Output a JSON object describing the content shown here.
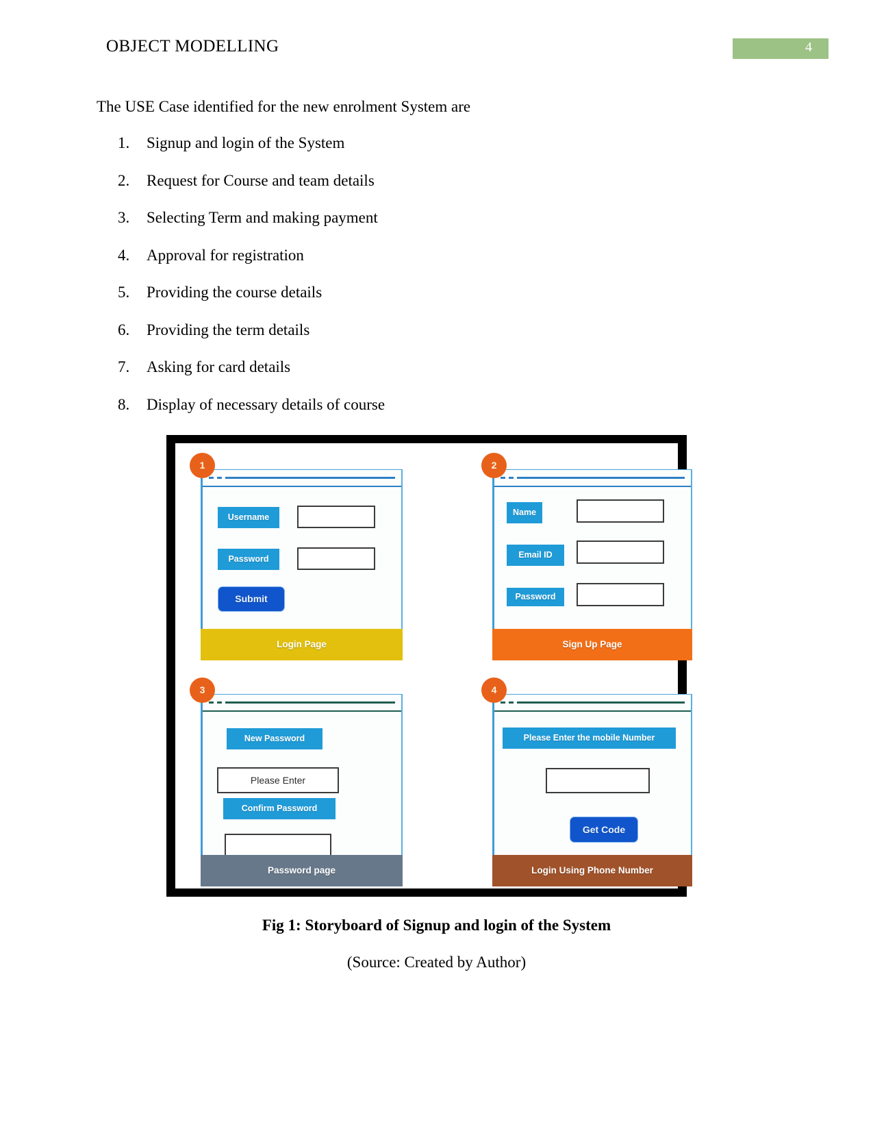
{
  "header": {
    "title": "OBJECT MODELLING",
    "page_number": "4",
    "badge_color": "#9DC285"
  },
  "body": {
    "intro": "The USE Case identified for the new enrolment System are",
    "use_cases": [
      {
        "num": "1.",
        "text": "Signup and login of the System"
      },
      {
        "num": "2.",
        "text": "Request for Course and team details"
      },
      {
        "num": "3.",
        "text": "Selecting Term and making payment"
      },
      {
        "num": "4.",
        "text": "Approval for registration"
      },
      {
        "num": "5.",
        "text": "Providing the course details"
      },
      {
        "num": "6.",
        "text": "Providing the term details"
      },
      {
        "num": "7.",
        "text": "Asking for card details"
      },
      {
        "num": "8.",
        "text": "Display of necessary details of course"
      }
    ]
  },
  "storyboard": {
    "panels": [
      {
        "step": "1",
        "footer_label": "Login Page",
        "footer_color": "#E2C00D",
        "fields": [
          {
            "label": "Username",
            "value": ""
          },
          {
            "label": "Password",
            "value": ""
          }
        ],
        "button": "Submit"
      },
      {
        "step": "2",
        "footer_label": "Sign Up Page",
        "footer_color": "#F26F17",
        "fields": [
          {
            "label": "Name",
            "value": ""
          },
          {
            "label": "Email ID",
            "value": ""
          },
          {
            "label": "Password",
            "value": ""
          }
        ],
        "button": ""
      },
      {
        "step": "3",
        "footer_label": "Password page",
        "footer_color": "#68788B",
        "fields": [
          {
            "label": "New Password",
            "value": "Please Enter"
          },
          {
            "label": "Confirm Password",
            "value": ""
          }
        ],
        "button": ""
      },
      {
        "step": "4",
        "footer_label": "Login Using Phone Number",
        "footer_color": "#A0522A",
        "fields": [
          {
            "label": "Please  Enter the mobile Number",
            "value": ""
          }
        ],
        "button": "Get Code"
      }
    ]
  },
  "caption": {
    "figure": "Fig 1: Storyboard of Signup and login of the System",
    "source": "(Source: Created by Author)"
  }
}
